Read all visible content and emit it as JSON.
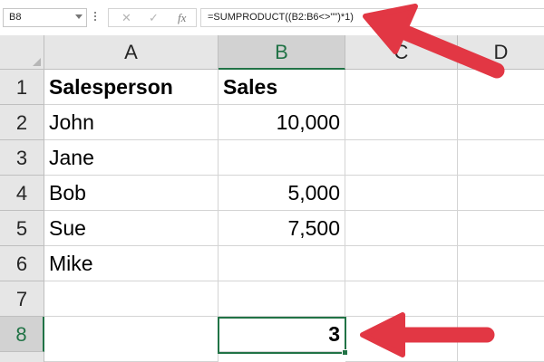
{
  "name_box": {
    "value": "B8"
  },
  "formula_bar": {
    "cancel_icon": "✕",
    "enter_icon": "✓",
    "fx_label": "fx",
    "formula": "=SUMPRODUCT((B2:B6<>\"\")*1)"
  },
  "columns": [
    "A",
    "B",
    "C",
    "D"
  ],
  "rows": [
    "1",
    "2",
    "3",
    "4",
    "5",
    "6",
    "7",
    "8"
  ],
  "cells": {
    "A1": "Salesperson",
    "B1": "Sales",
    "A2": "John",
    "B2": "10,000",
    "A3": "Jane",
    "B3": "",
    "A4": "Bob",
    "B4": "5,000",
    "A5": "Sue",
    "B5": "7,500",
    "A6": "Mike",
    "B6": "",
    "A7": "",
    "B7": "",
    "A8": "",
    "B8": "3"
  },
  "selection": {
    "active_cell": "B8"
  },
  "annotations": {
    "arrow_color": "#e23744",
    "accent_color": "#217346"
  }
}
